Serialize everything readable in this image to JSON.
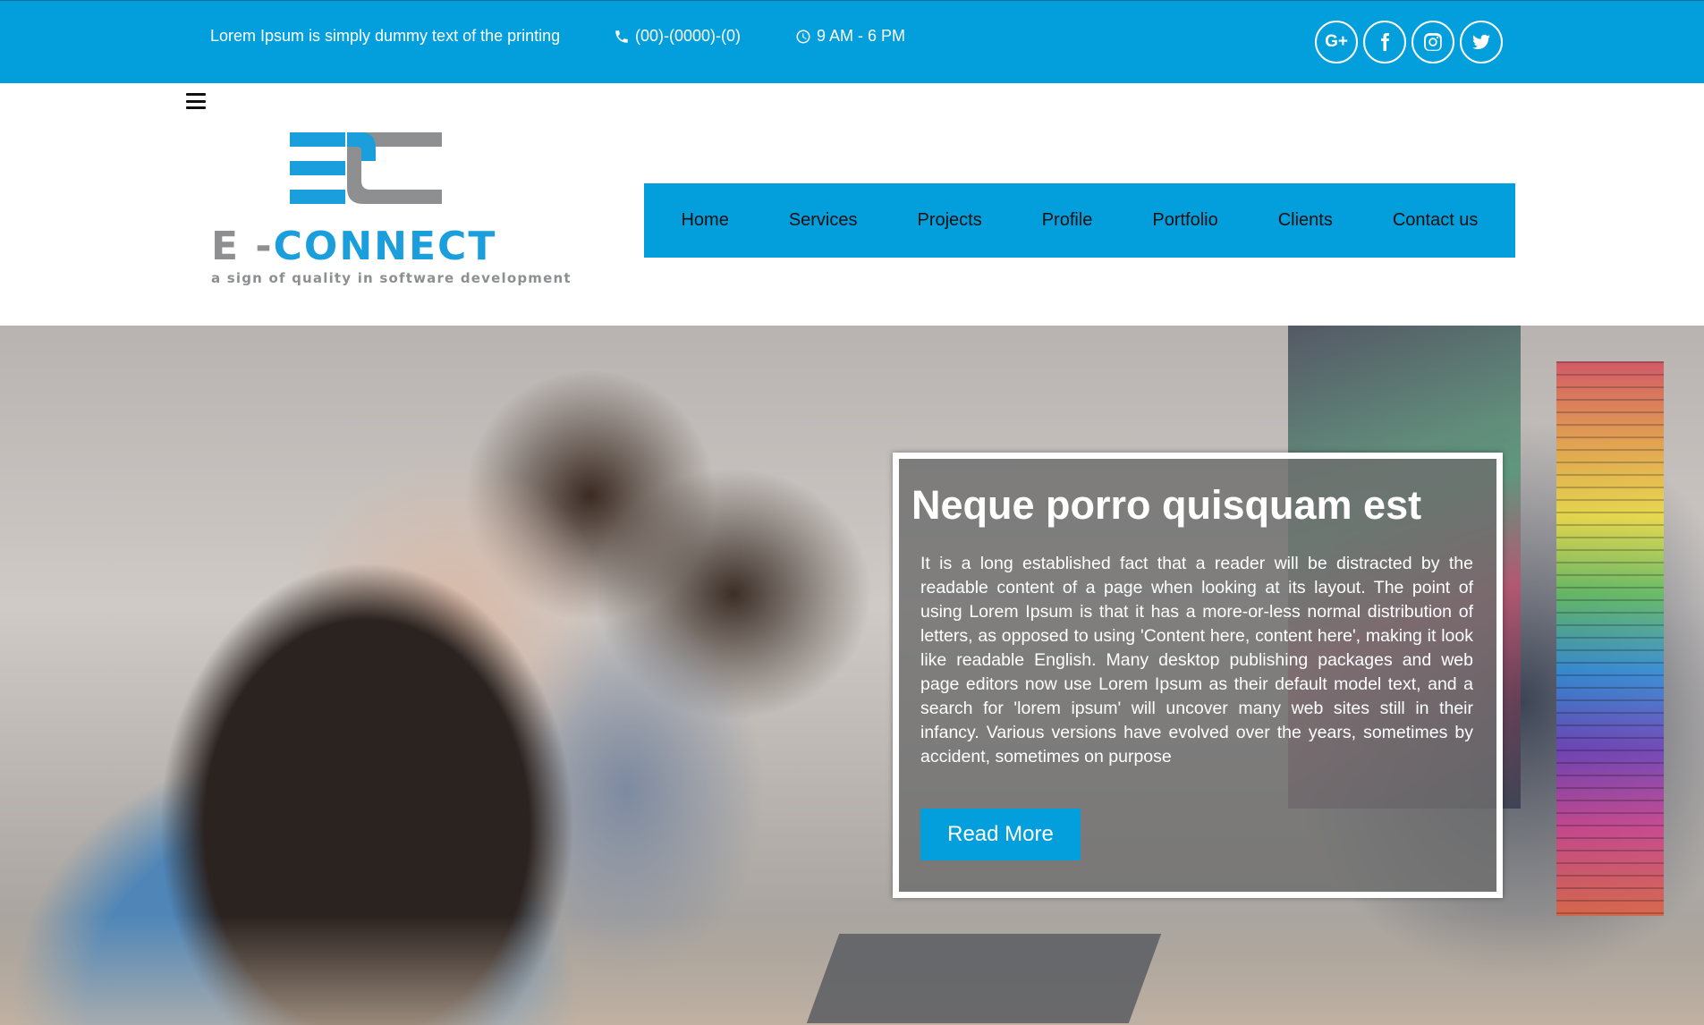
{
  "topbar": {
    "tagline": "Lorem Ipsum is simply dummy text of the printing",
    "phone": "(00)-(0000)-(0)",
    "hours": "9 AM - 6 PM",
    "social": [
      {
        "icon": "google-plus-icon",
        "label": "G+"
      },
      {
        "icon": "facebook-icon"
      },
      {
        "icon": "instagram-icon"
      },
      {
        "icon": "twitter-icon"
      }
    ]
  },
  "brand": {
    "name_left": "E -",
    "name_right": "CONNECT",
    "tagline": "a sign of quality in software development",
    "colors": {
      "blue": "#1a9fdc",
      "gray": "#8d8f91"
    }
  },
  "nav": {
    "items": [
      "Home",
      "Services",
      "Projects",
      "Profile",
      "Portfolio",
      "Clients",
      "Contact us"
    ]
  },
  "hero": {
    "title": "Neque porro quisquam est",
    "body": "It is a long established fact that a reader will be distracted by the readable content of a page when looking at its layout. The point of using Lorem Ipsum is that it has a more-or-less normal distribution of letters, as opposed to using 'Content here, content here', making it look like readable English. Many desktop publishing packages and web page editors now use Lorem Ipsum as their default model text, and a search for 'lorem ipsum' will uncover many web sites still in their infancy. Various versions have evolved over the years, sometimes by accident, sometimes on purpose",
    "button": "Read More"
  },
  "theme": {
    "accent": "#039fdc",
    "white": "#ffffff"
  }
}
